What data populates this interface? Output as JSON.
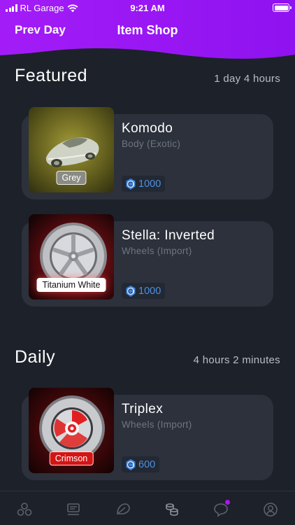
{
  "status_bar": {
    "carrier": "RL Garage",
    "time": "9:21 AM"
  },
  "header": {
    "prev_label": "Prev Day",
    "title": "Item Shop",
    "accent_color": "#9b17f5"
  },
  "featured": {
    "title": "Featured",
    "timer": "1 day 4 hours",
    "items": [
      {
        "name": "Komodo",
        "type": "Body (Exotic)",
        "paint": "Grey",
        "price": "1000"
      },
      {
        "name": "Stella: Inverted",
        "type": "Wheels (Import)",
        "paint": "Titanium White",
        "price": "1000"
      }
    ]
  },
  "daily": {
    "title": "Daily",
    "timer": "4 hours 2 minutes",
    "items": [
      {
        "name": "Triplex",
        "type": "Wheels (Import)",
        "paint": "Crimson",
        "price": "600"
      }
    ]
  },
  "tabbar": {
    "icons": [
      "items-icon",
      "trades-icon",
      "garage-icon",
      "shop-icon",
      "messages-icon",
      "profile-icon"
    ],
    "active": "shop-icon",
    "notification_color": "#b012f0"
  },
  "colors": {
    "background": "#1d2129",
    "card": "#2c313c",
    "price_text": "#4d90dd",
    "muted_text": "#6f7581"
  }
}
